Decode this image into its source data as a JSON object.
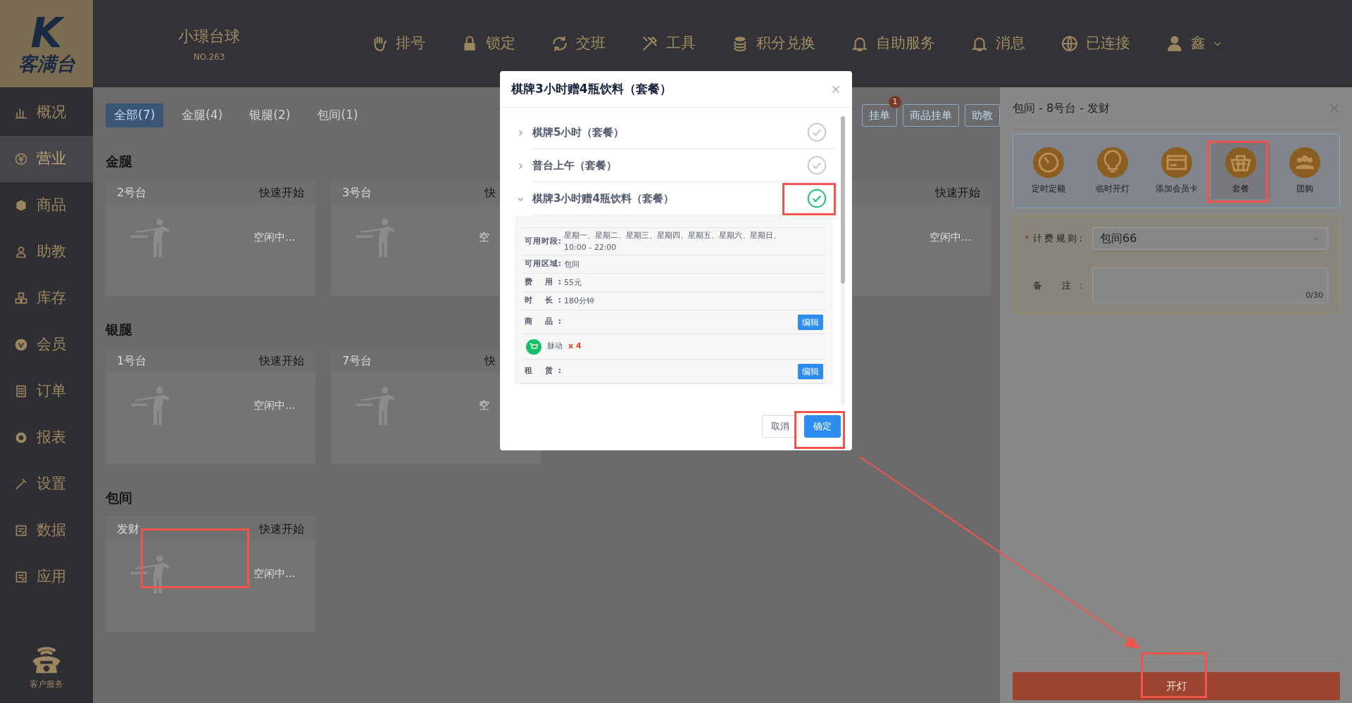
{
  "header": {
    "logo_mark": "K",
    "logo_text": "客满台",
    "venue": "小璟台球",
    "venue_no": "NO.263",
    "nav": [
      {
        "label": "排号"
      },
      {
        "label": "锁定"
      },
      {
        "label": "交班"
      },
      {
        "label": "工具"
      },
      {
        "label": "积分兑换"
      },
      {
        "label": "自助服务"
      },
      {
        "label": "消息"
      },
      {
        "label": "已连接"
      }
    ],
    "user": "鑫"
  },
  "sidebar": {
    "items": [
      {
        "label": "概况",
        "selected": false
      },
      {
        "label": "营业",
        "selected": true
      },
      {
        "label": "商品",
        "selected": false
      },
      {
        "label": "助教",
        "selected": false
      },
      {
        "label": "库存",
        "selected": false
      },
      {
        "label": "会员",
        "selected": false
      },
      {
        "label": "订单",
        "selected": false
      },
      {
        "label": "报表",
        "selected": false
      },
      {
        "label": "设置",
        "selected": false
      },
      {
        "label": "数据",
        "selected": false
      },
      {
        "label": "应用",
        "selected": false
      }
    ],
    "service": "客户服务"
  },
  "main": {
    "tabs": [
      {
        "label": "全部(7)",
        "selected": true
      },
      {
        "label": "金腿(4)",
        "selected": false
      },
      {
        "label": "银腿(2)",
        "selected": false
      },
      {
        "label": "包间(1)",
        "selected": false
      }
    ],
    "toolbar": [
      {
        "label": "挂单",
        "badge": "1"
      },
      {
        "label": "商品挂单"
      },
      {
        "label": "助教"
      }
    ],
    "sections": [
      {
        "title": "金腿",
        "tables": [
          {
            "name": "2号台",
            "action": "快速开始",
            "status": "空闲中..."
          },
          {
            "name": "3号台",
            "action": "快",
            "status": "空"
          },
          {
            "action": "快速开始",
            "status": "空闲中..."
          }
        ]
      },
      {
        "title": "银腿",
        "tables": [
          {
            "name": "1号台",
            "action": "快速开始",
            "status": "空闲中..."
          },
          {
            "name": "7号台",
            "action": "快",
            "status": "空"
          }
        ]
      },
      {
        "title": "包间",
        "tables": [
          {
            "name": "发财",
            "action": "快速开始",
            "status": "空闲中..."
          }
        ]
      }
    ]
  },
  "modal": {
    "title": "棋牌3小时赠4瓶饮料（套餐）",
    "packages": [
      {
        "name": "棋牌5小时（套餐）",
        "expanded": false,
        "selected": false
      },
      {
        "name": "普台上午（套餐）",
        "expanded": false,
        "selected": false
      },
      {
        "name": "棋牌3小时赠4瓶饮料（套餐）",
        "expanded": true,
        "selected": true
      }
    ],
    "details": [
      {
        "kind": "info",
        "label": "可用时段:",
        "value_lines": [
          "星期一、星期二、星期三、星期四、星期五、星期六、星期日、",
          "10:00 - 22:00"
        ]
      },
      {
        "kind": "info",
        "label": "可用区域:",
        "value_lines": [
          "包间"
        ]
      },
      {
        "kind": "info",
        "label": "费 用:",
        "value_lines": [
          "55元"
        ]
      },
      {
        "kind": "info",
        "label": "时 长:",
        "value_lines": [
          "180分钟"
        ]
      },
      {
        "kind": "section",
        "label": "商 品:",
        "button": "编辑"
      },
      {
        "kind": "goods",
        "name": "脉动",
        "quantity": "x 4"
      },
      {
        "kind": "section",
        "label": "租 赁:",
        "button": "编辑"
      }
    ],
    "cancel": "取消",
    "confirm": "确定"
  },
  "drawer": {
    "title": "包间 - 8号台 - 发财",
    "options": [
      {
        "label": "定时定额",
        "selected": false
      },
      {
        "label": "临时开灯",
        "selected": false
      },
      {
        "label": "添加会员卡",
        "selected": false
      },
      {
        "label": "套餐",
        "selected": true
      },
      {
        "label": "团购",
        "selected": false
      }
    ],
    "fields": [
      {
        "kind": "select",
        "required_mark": "*",
        "label": "计费规则:",
        "value": "包间66"
      },
      {
        "kind": "textarea",
        "label": "备 注:",
        "counter": "0/30"
      }
    ],
    "submit": "开灯"
  }
}
